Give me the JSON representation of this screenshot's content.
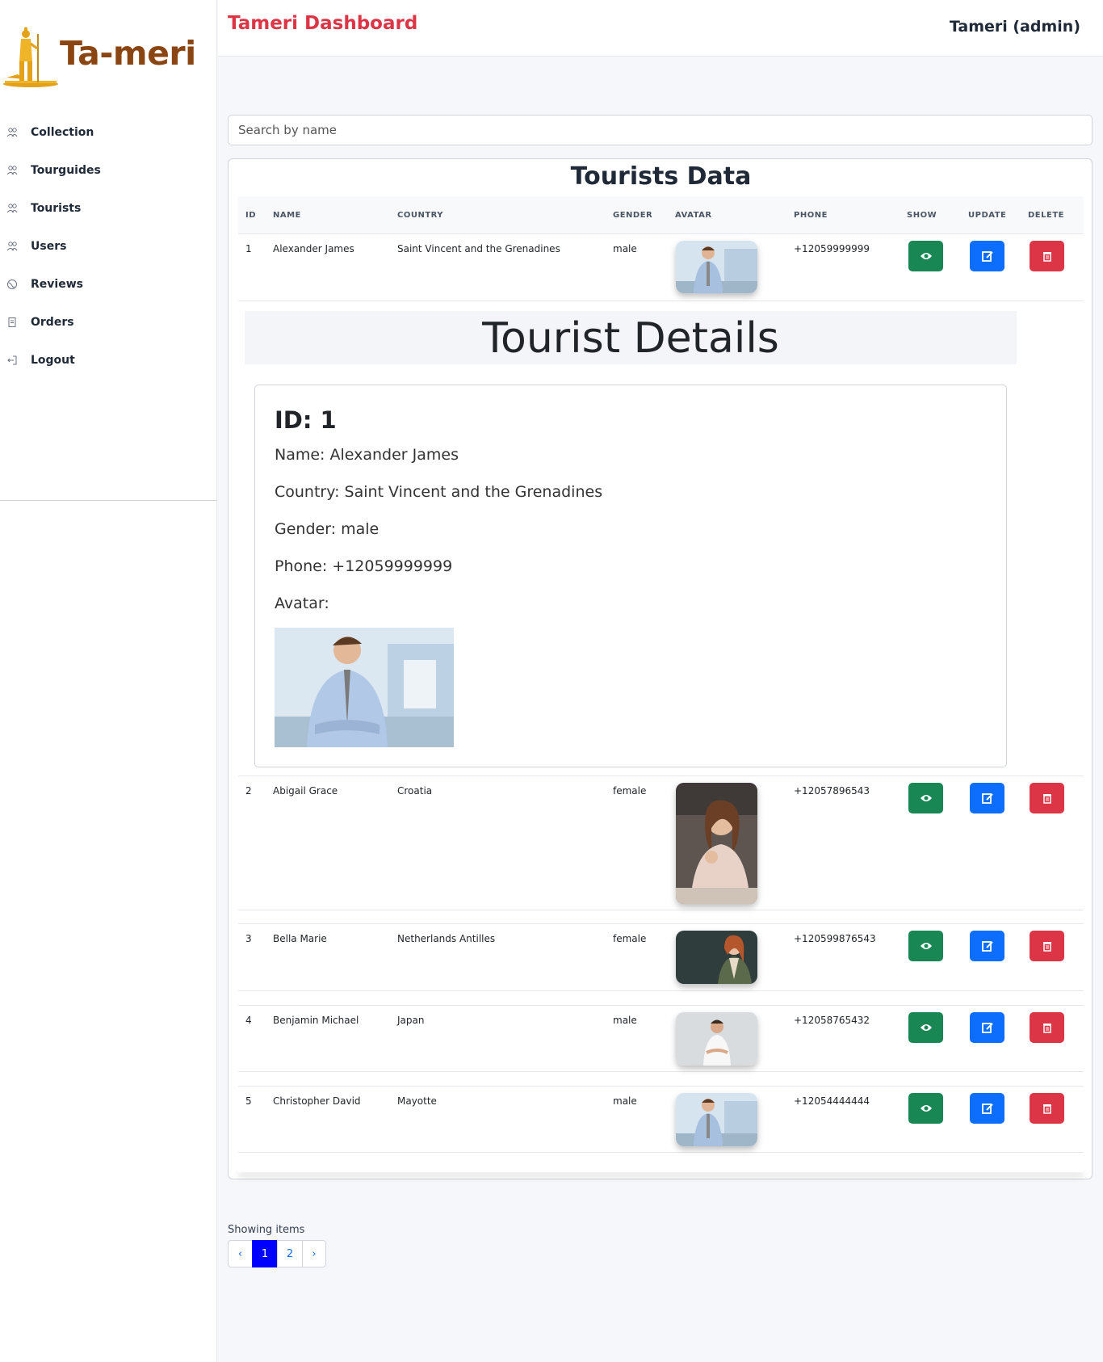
{
  "brand": {
    "logo_text": "Ta-meri"
  },
  "sidebar": {
    "items": [
      {
        "label": "Collection",
        "icon": "users-icon"
      },
      {
        "label": "Tourguides",
        "icon": "users-icon"
      },
      {
        "label": "Tourists",
        "icon": "users-icon"
      },
      {
        "label": "Users",
        "icon": "users-icon"
      },
      {
        "label": "Reviews",
        "icon": "globe-icon"
      },
      {
        "label": "Orders",
        "icon": "document-icon"
      },
      {
        "label": "Logout",
        "icon": "logout-icon"
      }
    ]
  },
  "header": {
    "title": "Tameri Dashboard",
    "user": "Tameri (admin)"
  },
  "search": {
    "placeholder": "Search by name",
    "value": ""
  },
  "table": {
    "title": "Tourists Data",
    "columns": [
      "ID",
      "NAME",
      "COUNTRY",
      "GENDER",
      "AVATAR",
      "PHONE",
      "SHOW",
      "UPDATE",
      "DELETE"
    ],
    "rows": [
      {
        "id": "1",
        "name": "Alexander James",
        "country": "Saint Vincent and the Grenadines",
        "gender": "male",
        "phone": "+12059999999"
      },
      {
        "id": "2",
        "name": "Abigail Grace",
        "country": "Croatia",
        "gender": "female",
        "phone": "+12057896543"
      },
      {
        "id": "3",
        "name": "Bella Marie",
        "country": "Netherlands Antilles",
        "gender": "female",
        "phone": "+120599876543"
      },
      {
        "id": "4",
        "name": "Benjamin Michael",
        "country": "Japan",
        "gender": "male",
        "phone": "+12058765432"
      },
      {
        "id": "5",
        "name": "Christopher David",
        "country": "Mayotte",
        "gender": "male",
        "phone": "+12054444444"
      }
    ]
  },
  "details": {
    "title": "Tourist Details",
    "id_line": "ID: 1",
    "name_line": "Name: Alexander James",
    "country_line": "Country: Saint Vincent and the Grenadines",
    "gender_line": "Gender: male",
    "phone_line": "Phone: +12059999999",
    "avatar_label": "Avatar:"
  },
  "pagination": {
    "label": "Showing items",
    "prev": "‹",
    "pages": [
      "1",
      "2"
    ],
    "next": "›",
    "active_page": "1"
  },
  "colors": {
    "accent_red": "#dc3545",
    "show_green": "#198754",
    "update_blue": "#0d6efd",
    "delete_red": "#dc3545",
    "logo_brown": "#8b4513",
    "active_page": "#0000ff"
  }
}
